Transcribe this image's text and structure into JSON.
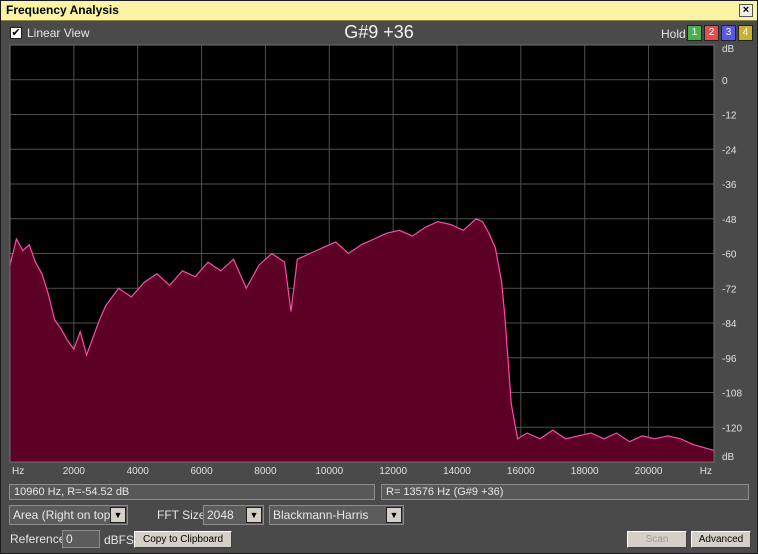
{
  "window": {
    "title": "Frequency Analysis",
    "close_label": "×"
  },
  "top": {
    "linear_view_checked": true,
    "linear_view_label": "Linear View",
    "note_readout": "G#9 +36",
    "hold_label": "Hold",
    "hold_buttons": [
      {
        "label": "1",
        "color": "#4caf50"
      },
      {
        "label": "2",
        "color": "#e05050"
      },
      {
        "label": "3",
        "color": "#5a5ae0"
      },
      {
        "label": "4",
        "color": "#c8b030"
      }
    ]
  },
  "chart_data": {
    "type": "area",
    "x_axis": {
      "min": 0,
      "max": 22050,
      "unit_label": "Hz",
      "ticks": [
        2000,
        4000,
        6000,
        8000,
        10000,
        12000,
        14000,
        16000,
        18000,
        20000
      ]
    },
    "y_axis": {
      "min": -132,
      "max": 12,
      "unit_label": "dB",
      "ticks": [
        0,
        -12,
        -24,
        -36,
        -48,
        -60,
        -72,
        -84,
        -96,
        -108,
        -120
      ]
    },
    "colors": {
      "fill": "#5c0026",
      "line": "#ff4aa6",
      "grid": "#505050",
      "background": "#000000"
    },
    "x": [
      0,
      200,
      400,
      600,
      800,
      1000,
      1200,
      1400,
      1600,
      1800,
      2000,
      2200,
      2400,
      2600,
      2800,
      3000,
      3400,
      3800,
      4200,
      4600,
      5000,
      5400,
      5800,
      6200,
      6600,
      7000,
      7400,
      7800,
      8200,
      8600,
      8800,
      9000,
      9400,
      9800,
      10200,
      10600,
      11000,
      11400,
      11800,
      12200,
      12600,
      13000,
      13400,
      13800,
      14200,
      14600,
      14800,
      15000,
      15200,
      15400,
      15500,
      15700,
      15900,
      16200,
      16600,
      17000,
      17400,
      17800,
      18200,
      18600,
      19000,
      19400,
      19800,
      20200,
      20600,
      21000,
      21400,
      22050
    ],
    "y": [
      -64,
      -55,
      -59,
      -57,
      -63,
      -67,
      -74,
      -83,
      -86,
      -90,
      -93,
      -87,
      -95,
      -89,
      -83,
      -78,
      -72,
      -75,
      -70,
      -67,
      -71,
      -66,
      -68,
      -63,
      -66,
      -62,
      -72,
      -64,
      -60,
      -63,
      -80,
      -62,
      -60,
      -58,
      -56,
      -60,
      -57,
      -55,
      -53,
      -52,
      -54,
      -51,
      -49,
      -50,
      -52,
      -48,
      -49,
      -53,
      -58,
      -70,
      -82,
      -112,
      -124,
      -122,
      -124,
      -121,
      -124,
      -123,
      -122,
      -124,
      -122,
      -125,
      -123,
      -124,
      -123,
      -124,
      -126,
      -128
    ]
  },
  "status": {
    "cursor_readout": "10960 Hz, R=-54.52 dB",
    "peak_readout": "R=  13576 Hz (G#9 +36)"
  },
  "controls": {
    "display_mode": "Area (Right on top)",
    "fft_size_label": "FFT Size",
    "fft_size": "2048",
    "window_function": "Blackmann-Harris",
    "reference_label": "Reference",
    "reference_value": "0",
    "reference_unit": "dBFS",
    "copy_button": "Copy to Clipboard",
    "scan_button": "Scan",
    "advanced_button": "Advanced"
  }
}
